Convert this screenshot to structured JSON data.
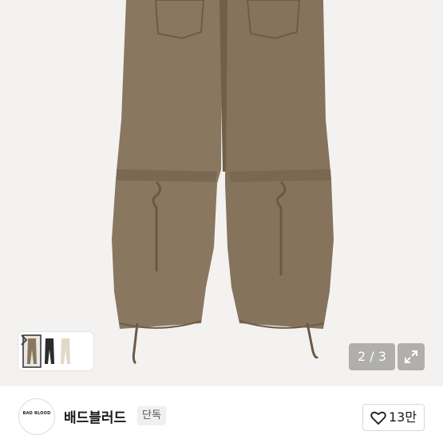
{
  "gallery": {
    "counter": "2 / 3",
    "thumbnail_count": 3,
    "expand_icon": "expand-icon",
    "thumb_next_icon": "chevron-right-icon"
  },
  "shop": {
    "logo_text": "BAD BLOOD",
    "name": "배드블러드",
    "badge": "단독",
    "like_count": "13만",
    "like_icon": "heart-icon"
  },
  "colors": {
    "pants": "#8a7760",
    "background": "#f3f2f0"
  }
}
